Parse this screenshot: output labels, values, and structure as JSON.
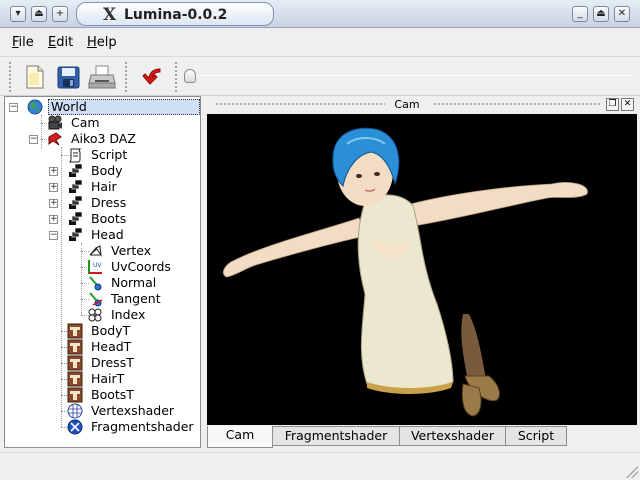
{
  "window": {
    "title": "Lumina-0.0.2",
    "left_buttons": [
      "menu-icon",
      "shade-icon",
      "pin-icon"
    ],
    "right_buttons": [
      "minimize-icon",
      "maximize-icon",
      "close-icon"
    ]
  },
  "menubar": {
    "file": {
      "accel": "F",
      "rest": "ile"
    },
    "edit": {
      "accel": "E",
      "rest": "dit"
    },
    "help": {
      "accel": "H",
      "rest": "elp"
    }
  },
  "toolbar": {
    "tools": [
      "new-file-icon",
      "save-icon",
      "print-icon",
      "undo-icon"
    ],
    "timeline_position": 0
  },
  "tree": {
    "items": [
      {
        "label": "World",
        "icon": "globe-icon",
        "selected": true
      },
      {
        "label": "Cam",
        "icon": "camera-icon"
      },
      {
        "label": "Aiko3 DAZ",
        "icon": "figure-icon"
      },
      {
        "label": "Script",
        "icon": "script-icon"
      },
      {
        "label": "Body",
        "icon": "mesh-icon"
      },
      {
        "label": "Hair",
        "icon": "mesh-icon"
      },
      {
        "label": "Dress",
        "icon": "mesh-icon"
      },
      {
        "label": "Boots",
        "icon": "mesh-icon"
      },
      {
        "label": "Head",
        "icon": "mesh-icon"
      },
      {
        "label": "Vertex",
        "icon": "vertex-icon"
      },
      {
        "label": "UvCoords",
        "icon": "uv-icon"
      },
      {
        "label": "Normal",
        "icon": "normal-icon"
      },
      {
        "label": "Tangent",
        "icon": "tangent-icon"
      },
      {
        "label": "Index",
        "icon": "index-icon"
      },
      {
        "label": "BodyT",
        "icon": "texture-icon"
      },
      {
        "label": "HeadT",
        "icon": "texture-icon"
      },
      {
        "label": "DressT",
        "icon": "texture-icon"
      },
      {
        "label": "HairT",
        "icon": "texture-icon"
      },
      {
        "label": "BootsT",
        "icon": "texture-icon"
      },
      {
        "label": "Vertexshader",
        "icon": "vertex-shader-icon"
      },
      {
        "label": "Fragmentshader",
        "icon": "fragment-shader-icon"
      }
    ],
    "uv_icon_text": "UV"
  },
  "dock": {
    "title": "Cam",
    "buttons": [
      "float-icon",
      "close-icon"
    ]
  },
  "tabs": [
    {
      "label": "Cam",
      "active": true
    },
    {
      "label": "Fragmentshader",
      "active": false
    },
    {
      "label": "Vertexshader",
      "active": false
    },
    {
      "label": "Script",
      "active": false
    }
  ]
}
